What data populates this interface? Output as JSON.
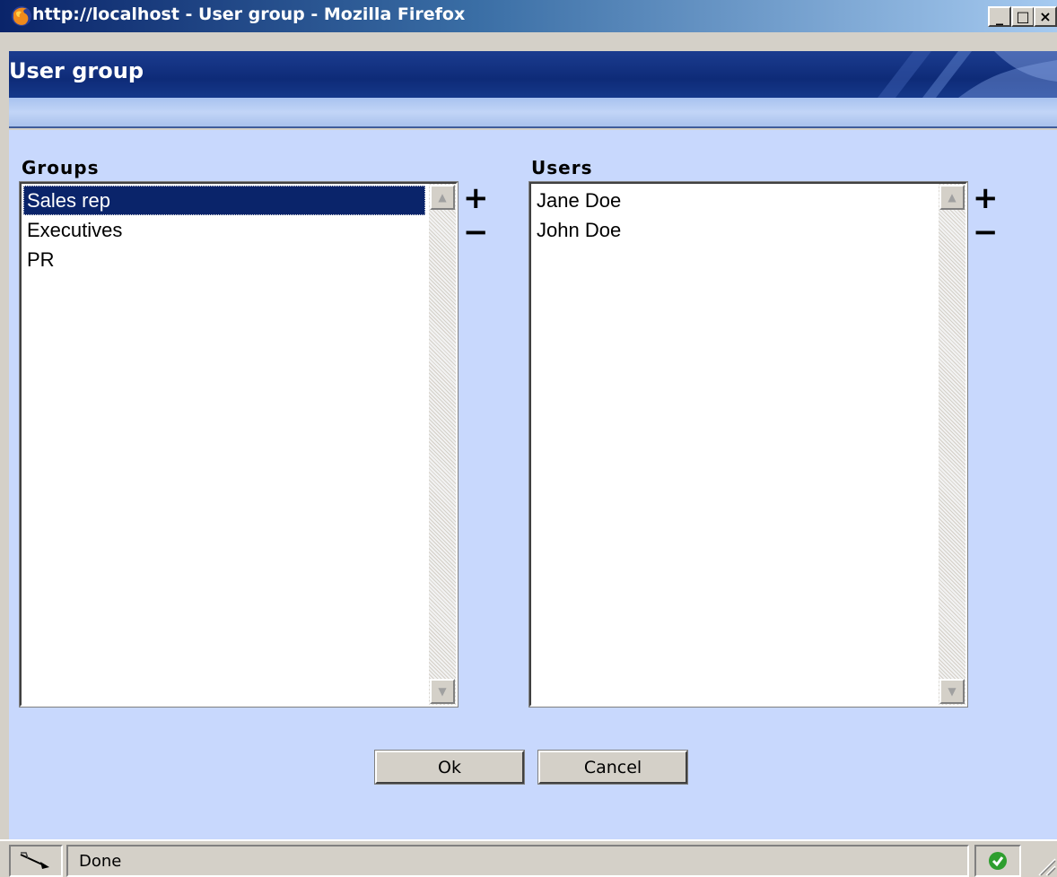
{
  "window": {
    "title": "http://localhost - User group - Mozilla Firefox",
    "minimize_glyph": "_",
    "maximize_glyph": "□",
    "close_glyph": "×"
  },
  "header": {
    "title": "User group"
  },
  "groups": {
    "label": "Groups",
    "items": [
      "Sales rep",
      "Executives",
      "PR"
    ],
    "selected": "Sales rep",
    "add_glyph": "+",
    "remove_glyph": "−"
  },
  "users": {
    "label": "Users",
    "items": [
      "Jane Doe",
      "John Doe"
    ],
    "add_glyph": "+",
    "remove_glyph": "−"
  },
  "buttons": {
    "ok_label": "Ok",
    "cancel_label": "Cancel"
  },
  "status": {
    "text": "Done"
  },
  "colors": {
    "titlebar_start": "#0a246a",
    "header_blue": "#0e2b78",
    "content_bg": "#c8d8fd",
    "selection": "#0a246a",
    "secure_ok": "#2e9e2e"
  },
  "icons": {
    "app": "firefox-icon",
    "status_left": "connection-icon",
    "status_right": "check-icon"
  }
}
